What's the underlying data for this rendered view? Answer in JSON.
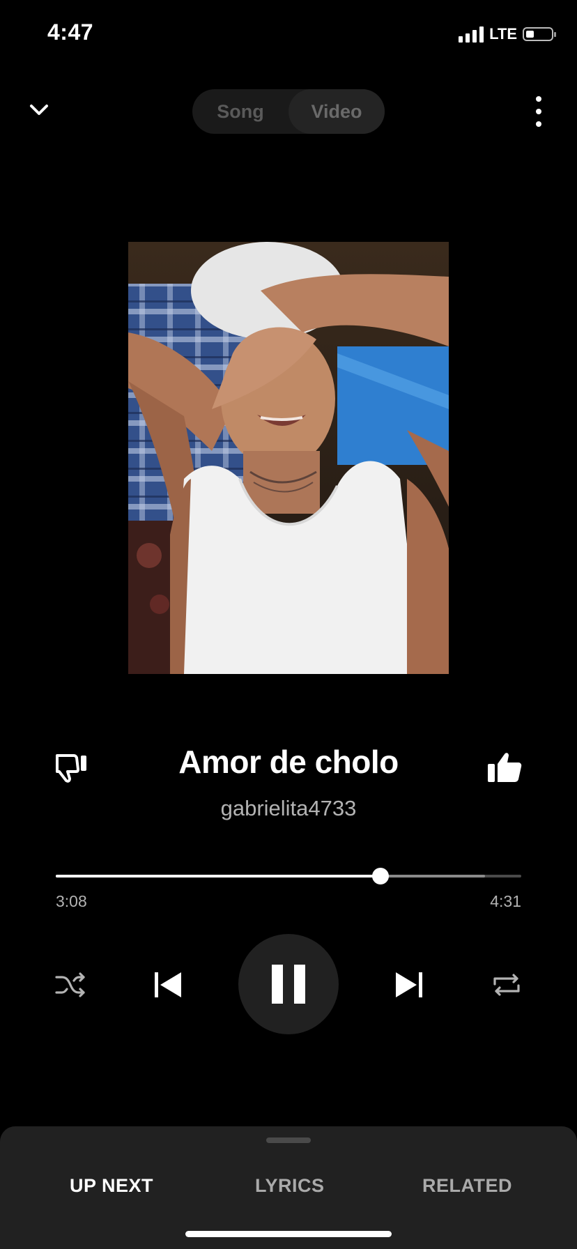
{
  "status_bar": {
    "time": "4:47",
    "network": "LTE",
    "battery_level": 0.25
  },
  "top_bar": {
    "collapse_icon": "chevron-down-icon",
    "toggle": {
      "song_label": "Song",
      "video_label": "Video",
      "selected": "Video"
    },
    "more_icon": "more-vertical-icon"
  },
  "artwork": {
    "icon": "album-art-image"
  },
  "track": {
    "title": "Amor de cholo",
    "artist": "gabrielita4733",
    "dislike_icon": "thumbs-down-icon",
    "like_icon": "thumbs-up-icon",
    "liked": true
  },
  "progress": {
    "elapsed": "3:08",
    "total": "4:31",
    "fraction_played": 0.69,
    "fraction_buffered": 0.92
  },
  "controls": {
    "shuffle_icon": "shuffle-icon",
    "previous_icon": "skip-previous-icon",
    "play_state": "playing",
    "pause_icon": "pause-icon",
    "next_icon": "skip-next-icon",
    "repeat_icon": "repeat-icon"
  },
  "bottom_sheet": {
    "tabs": [
      {
        "label": "UP NEXT",
        "active": true
      },
      {
        "label": "LYRICS",
        "active": false
      },
      {
        "label": "RELATED",
        "active": false
      }
    ]
  },
  "colors": {
    "background": "#000000",
    "sheet": "#212121",
    "play_button": "#212121",
    "muted_text": "#b3b3b3"
  }
}
